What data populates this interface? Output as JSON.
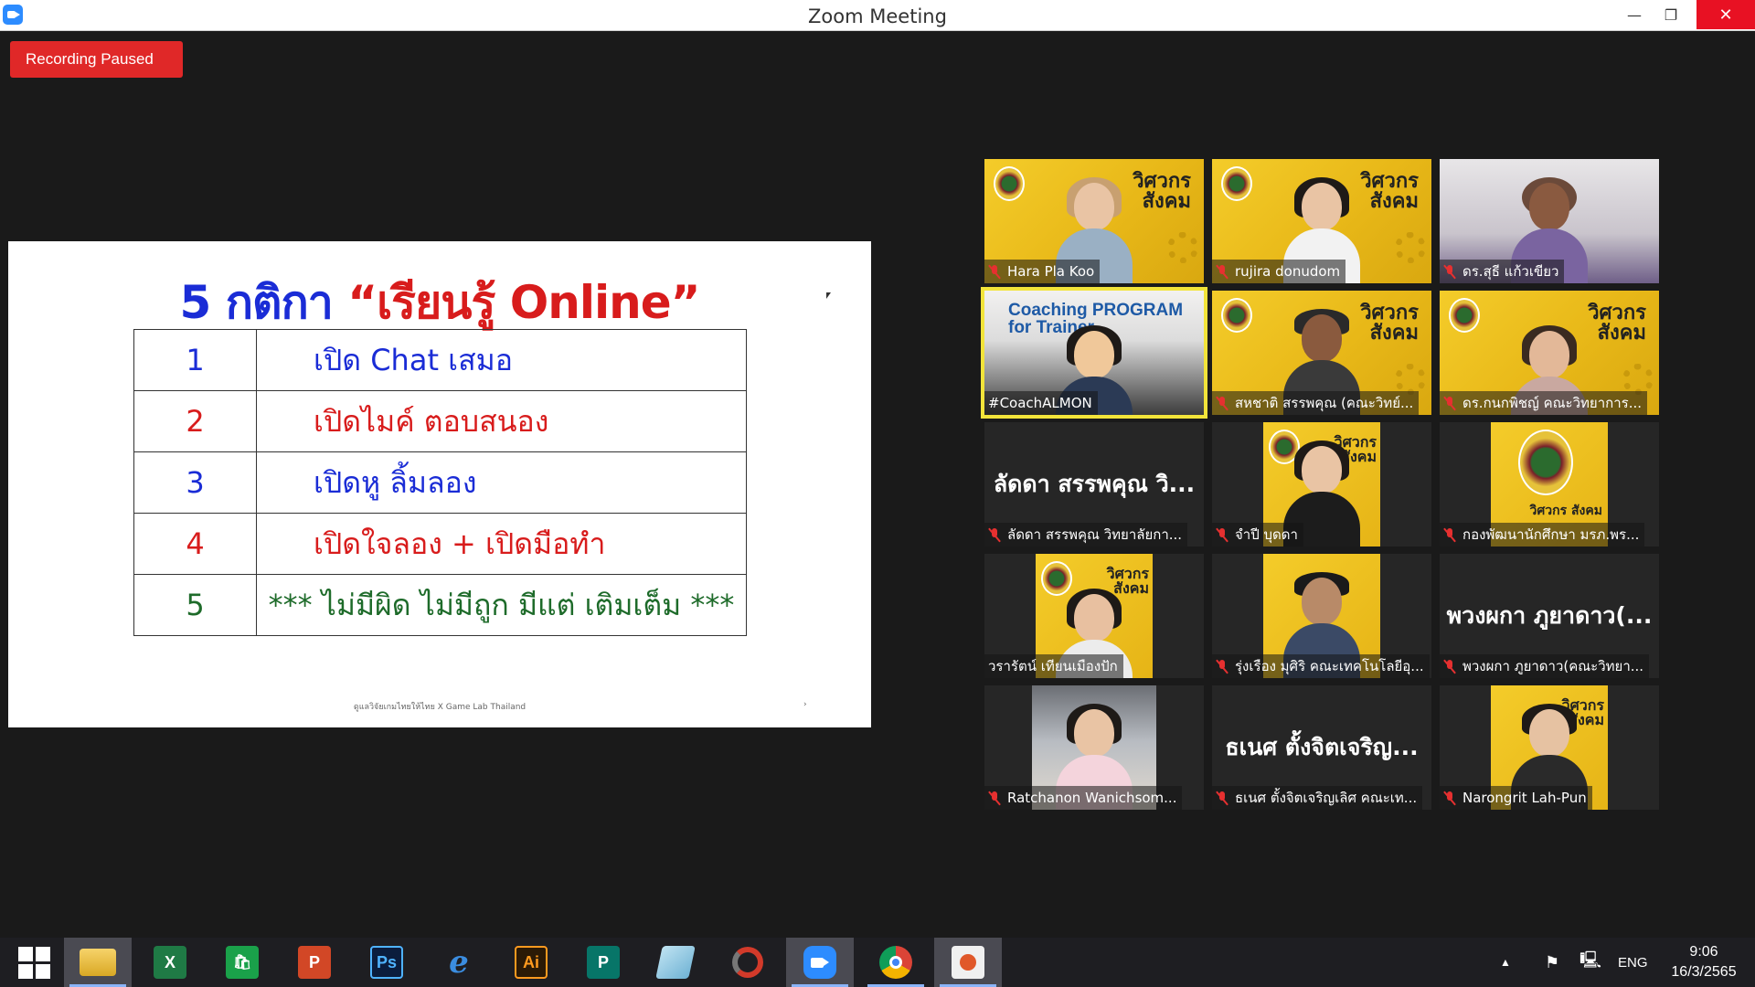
{
  "window": {
    "title": "Zoom Meeting",
    "minimize": "—",
    "maximize": "❐",
    "close": "✕"
  },
  "recording": {
    "label": "Recording Paused"
  },
  "slide": {
    "title_number": "5 กติกา ",
    "title_quoted": "“เรียนรู้ Online”",
    "rules": [
      {
        "num": "1",
        "text": "เปิด Chat เสมอ"
      },
      {
        "num": "2",
        "text": "เปิดไมค์ ตอบสนอง"
      },
      {
        "num": "3",
        "text": "เปิดหู ลิ้มลอง"
      },
      {
        "num": "4",
        "text": "เปิดใจลอง + เปิดมือทำ"
      },
      {
        "num": "5",
        "text": "*** ไม่มีผิด ไม่มีถูก มีแต่ เติมเต็ม ***"
      }
    ],
    "footer": "ดูแลวิจัยเกมไทยให้ไทย X Game Lab Thailand",
    "page": "›"
  },
  "gallery": {
    "brand": "วิศวกร สังคม",
    "coach_banner": "Coaching PROGRAM for Trainer",
    "participants": [
      {
        "name": "Hara Pla Koo",
        "muted": true
      },
      {
        "name": "rujira donudom",
        "muted": true
      },
      {
        "name": "ดร.สุธี แก้วเขียว",
        "muted": true
      },
      {
        "name": "#CoachALMON",
        "muted": false
      },
      {
        "name": "สหชาติ สรรพคุณ (คณะวิทย์...",
        "muted": true
      },
      {
        "name": "ดร.กนกพิชญ์ คณะวิทยาการ...",
        "muted": true
      },
      {
        "name": "ลัดดา สรรพคุณ วิทยาลัยกา...",
        "display": "ลัดดา สรรพคุณ วิ...",
        "muted": true
      },
      {
        "name": "จำปี บุดดา",
        "muted": true
      },
      {
        "name": "กองพัฒนานักศึกษา มรภ.พร...",
        "muted": true
      },
      {
        "name": "วรารัตน์ เทียนเมืองปัก",
        "muted": false
      },
      {
        "name": "รุ่งเรือง มุศิริ คณะเทคโนโลยีอุ...",
        "muted": true
      },
      {
        "name": "พวงผกา ภูยาดาว(คณะวิทยา...",
        "display": "พวงผกา ภูยาดาว(...",
        "muted": true
      },
      {
        "name": "Ratchanon Wanichsom...",
        "muted": true
      },
      {
        "name": "ธเนศ ตั้งจิตเจริญเลิศ คณะเท...",
        "display": "ธเนศ ตั้งจิตเจริญ...",
        "muted": true
      },
      {
        "name": "Narongrit Lah-Pun",
        "muted": true
      }
    ]
  },
  "taskbar": {
    "apps": [
      "start",
      "file-explorer",
      "excel",
      "store",
      "powerpoint",
      "photoshop",
      "internet-explorer",
      "illustrator",
      "publisher",
      "notes",
      "photoscape",
      "zoom",
      "chrome",
      "presentation"
    ],
    "labels": {
      "excel": "X",
      "powerpoint": "P",
      "photoshop": "Ps",
      "illustrator": "Ai",
      "publisher": "P",
      "store": "🛍"
    },
    "language": "ENG",
    "time": "9:06",
    "date": "16/3/2565"
  }
}
